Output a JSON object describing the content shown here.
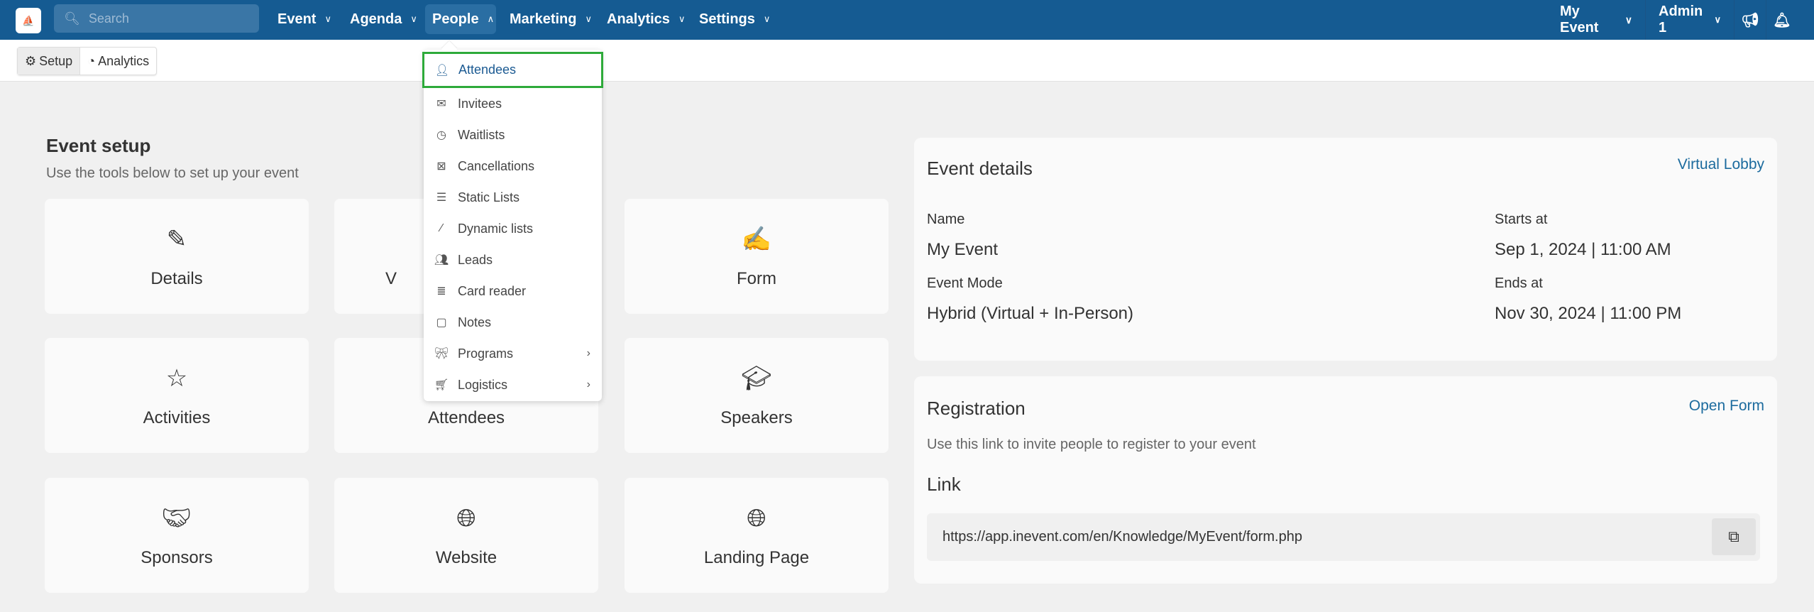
{
  "topbar": {
    "logo_icon": "inevent-logo",
    "search_placeholder": "Search",
    "nav": [
      {
        "label": "Event"
      },
      {
        "label": "Agenda"
      },
      {
        "label": "People",
        "open": true
      },
      {
        "label": "Marketing"
      },
      {
        "label": "Analytics"
      },
      {
        "label": "Settings"
      }
    ],
    "event_selector": "My Event",
    "user": "Admin 1",
    "icons": [
      "megaphone-icon",
      "bell-icon"
    ],
    "color": "#155b92"
  },
  "subbar": {
    "setup": "Setup",
    "analytics": "Analytics"
  },
  "people_menu": {
    "items": [
      {
        "label": "Attendees",
        "icon": "user-icon",
        "selected": true
      },
      {
        "label": "Invitees",
        "icon": "envelope-icon"
      },
      {
        "label": "Waitlists",
        "icon": "clock-icon"
      },
      {
        "label": "Cancellations",
        "icon": "cancel-ticket-icon"
      },
      {
        "label": "Static Lists",
        "icon": "list-icon"
      },
      {
        "label": "Dynamic lists",
        "icon": "magic-wand-icon"
      },
      {
        "label": "Leads",
        "icon": "users-icon"
      },
      {
        "label": "Card reader",
        "icon": "scanner-icon"
      },
      {
        "label": "Notes",
        "icon": "note-icon"
      },
      {
        "label": "Programs",
        "icon": "ribbon-icon",
        "submenu": true
      },
      {
        "label": "Logistics",
        "icon": "cart-icon",
        "submenu": true
      }
    ],
    "highlight_color": "#2eaa3a"
  },
  "setup": {
    "title": "Event setup",
    "subtitle": "Use the tools below to set up your event",
    "cards": [
      {
        "label": "Details",
        "icon": "pencil-icon"
      },
      {
        "label": "V",
        "icon": ""
      },
      {
        "label": "Form",
        "icon": "edit-square-icon"
      },
      {
        "label": "Activities",
        "icon": "star-icon"
      },
      {
        "label": "Attendees",
        "icon": ""
      },
      {
        "label": "Speakers",
        "icon": "graduation-cap-icon"
      },
      {
        "label": "Sponsors",
        "icon": "handshake-icon"
      },
      {
        "label": "Website",
        "icon": "globe-icon"
      },
      {
        "label": "Landing Page",
        "icon": "globe-icon"
      }
    ]
  },
  "event_details": {
    "title": "Event details",
    "link": "Virtual Lobby",
    "name_label": "Name",
    "name": "My Event",
    "mode_label": "Event Mode",
    "mode": "Hybrid (Virtual + In-Person)",
    "start_label": "Starts at",
    "start": "Sep 1, 2024 | 11:00 AM",
    "end_label": "Ends at",
    "end": "Nov 30, 2024 | 11:00 PM"
  },
  "registration": {
    "title": "Registration",
    "link": "Open Form",
    "description": "Use this link to invite people to register to your event",
    "link_label": "Link",
    "url": "https://app.inevent.com/en/Knowledge/MyEvent/form.php"
  }
}
